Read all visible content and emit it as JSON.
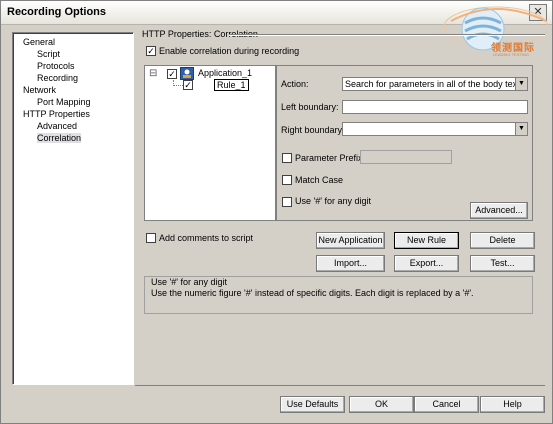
{
  "window": {
    "title": "Recording Options",
    "close_glyph": "✕"
  },
  "watermark": {
    "text": "领测国际",
    "subtext": "LEADING TESTING"
  },
  "nav": {
    "items": [
      {
        "label": "General"
      },
      {
        "label": "Script"
      },
      {
        "label": "Protocols"
      },
      {
        "label": "Recording"
      },
      {
        "label": "Network"
      },
      {
        "label": "Port Mapping"
      },
      {
        "label": "HTTP Properties"
      },
      {
        "label": "Advanced"
      },
      {
        "label": "Correlation"
      }
    ],
    "selected": "Correlation"
  },
  "panel": {
    "group_title": "HTTP Properties: Correlation",
    "enable_correlation": {
      "label": "Enable correlation during recording",
      "checked": true
    },
    "tree": {
      "expand_glyph": "⊟",
      "application": {
        "label": "Application_1",
        "checked": true
      },
      "rule": {
        "label": "Rule_1",
        "checked": true
      }
    },
    "action": {
      "label": "Action:",
      "value": "Search for parameters in all of the body text"
    },
    "left_boundary": {
      "label": "Left boundary:",
      "value": ""
    },
    "right_boundary": {
      "label": "Right boundary:",
      "value": ""
    },
    "parameter_prefix": {
      "label": "Parameter Prefix:",
      "checked": false,
      "value": ""
    },
    "match_case": {
      "label": "Match Case",
      "checked": false
    },
    "use_hash": {
      "label": "Use '#' for any digit",
      "checked": false
    },
    "advanced_button": "Advanced...",
    "add_comments": {
      "label": "Add comments to script",
      "checked": false
    },
    "buttons": {
      "new_application": "New Application",
      "new_rule": "New Rule",
      "delete": "Delete",
      "import": "Import...",
      "export": "Export...",
      "test": "Test..."
    },
    "description": {
      "title": "Use '#' for any digit",
      "text": "Use the numeric figure '#' instead of specific digits. Each digit is replaced by a '#'."
    }
  },
  "footer": {
    "use_defaults": "Use Defaults",
    "ok": "OK",
    "cancel": "Cancel",
    "help": "Help"
  }
}
